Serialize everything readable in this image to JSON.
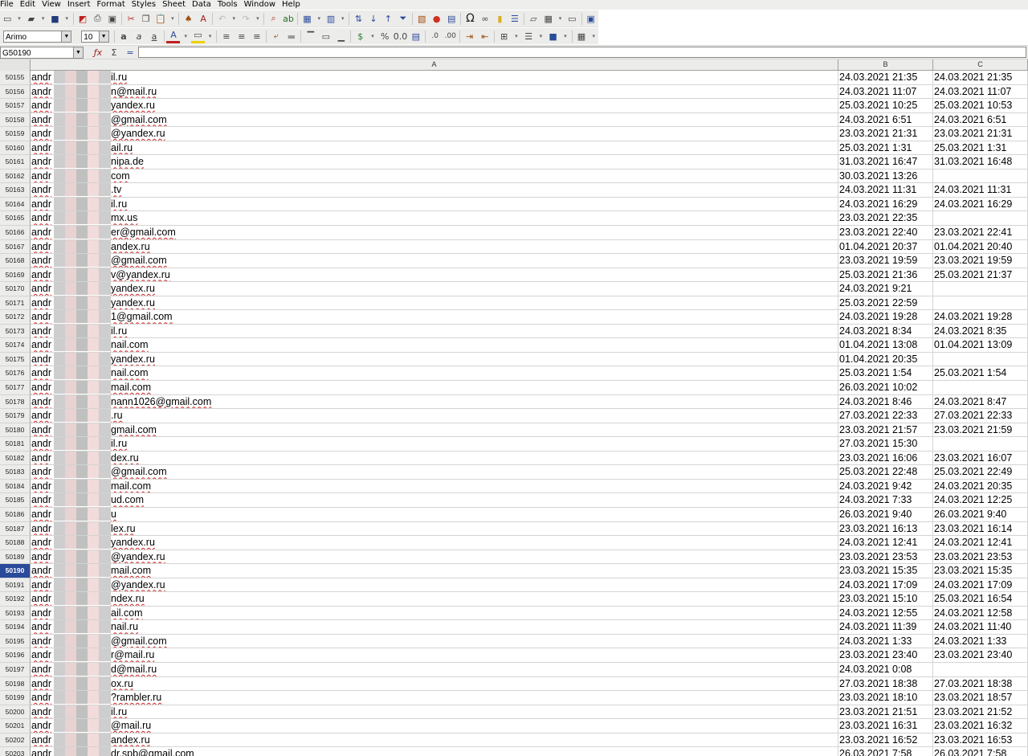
{
  "menu": [
    "File",
    "Edit",
    "View",
    "Insert",
    "Format",
    "Styles",
    "Sheet",
    "Data",
    "Tools",
    "Window",
    "Help"
  ],
  "font": {
    "name": "Arimo",
    "size": "10"
  },
  "name_box": "G50190",
  "columns": [
    "A",
    "B",
    "C"
  ],
  "active_row": "50190",
  "rows": [
    {
      "n": "50155",
      "pre": "andr",
      "suf": "il.ru",
      "b": "24.03.2021 21:35",
      "c": "24.03.2021 21:35"
    },
    {
      "n": "50156",
      "pre": "andr",
      "suf": "n@mail.ru",
      "b": "24.03.2021 11:07",
      "c": "24.03.2021 11:07"
    },
    {
      "n": "50157",
      "pre": "andr",
      "suf": "yandex.ru",
      "b": "25.03.2021 10:25",
      "c": "25.03.2021 10:53"
    },
    {
      "n": "50158",
      "pre": "andr",
      "suf": "@gmail.com",
      "b": "24.03.2021 6:51",
      "c": "24.03.2021 6:51"
    },
    {
      "n": "50159",
      "pre": "andr",
      "suf": "@yandex.ru",
      "b": "23.03.2021 21:31",
      "c": "23.03.2021 21:31"
    },
    {
      "n": "50160",
      "pre": "andr",
      "suf": "ail.ru",
      "b": "25.03.2021 1:31",
      "c": "25.03.2021 1:31"
    },
    {
      "n": "50161",
      "pre": "andr",
      "suf": "nipa.de",
      "b": "31.03.2021 16:47",
      "c": "31.03.2021 16:48"
    },
    {
      "n": "50162",
      "pre": "andr",
      "suf": "com",
      "b": "30.03.2021 13:26",
      "c": ""
    },
    {
      "n": "50163",
      "pre": "andr",
      "suf": ".tv",
      "b": "24.03.2021 11:31",
      "c": "24.03.2021 11:31"
    },
    {
      "n": "50164",
      "pre": "andr",
      "suf": "il.ru",
      "b": "24.03.2021 16:29",
      "c": "24.03.2021 16:29"
    },
    {
      "n": "50165",
      "pre": "andr",
      "suf": "mx.us",
      "b": "23.03.2021 22:35",
      "c": ""
    },
    {
      "n": "50166",
      "pre": "andr",
      "suf": "er@gmail.com",
      "b": "23.03.2021 22:40",
      "c": "23.03.2021 22:41"
    },
    {
      "n": "50167",
      "pre": "andr",
      "suf": "andex.ru",
      "b": "01.04.2021 20:37",
      "c": "01.04.2021 20:40"
    },
    {
      "n": "50168",
      "pre": "andr",
      "suf": "@gmail.com",
      "b": "23.03.2021 19:59",
      "c": "23.03.2021 19:59"
    },
    {
      "n": "50169",
      "pre": "andr",
      "suf": "v@yandex.ru",
      "b": "25.03.2021 21:36",
      "c": "25.03.2021 21:37"
    },
    {
      "n": "50170",
      "pre": "andr",
      "suf": "yandex.ru",
      "b": "24.03.2021 9:21",
      "c": ""
    },
    {
      "n": "50171",
      "pre": "andr",
      "suf": "yandex.ru",
      "b": "25.03.2021 22:59",
      "c": ""
    },
    {
      "n": "50172",
      "pre": "andr",
      "suf": "1@gmail.com",
      "b": "24.03.2021 19:28",
      "c": "24.03.2021 19:28"
    },
    {
      "n": "50173",
      "pre": "andr",
      "suf": "il.ru",
      "b": "24.03.2021 8:34",
      "c": "24.03.2021 8:35"
    },
    {
      "n": "50174",
      "pre": "andr",
      "suf": "nail.com",
      "b": "01.04.2021 13:08",
      "c": "01.04.2021 13:09"
    },
    {
      "n": "50175",
      "pre": "andr",
      "suf": "yandex.ru",
      "b": "01.04.2021 20:35",
      "c": ""
    },
    {
      "n": "50176",
      "pre": "andr",
      "suf": "nail.com",
      "b": "25.03.2021 1:54",
      "c": "25.03.2021 1:54"
    },
    {
      "n": "50177",
      "pre": "andr",
      "suf": "mail.com",
      "b": "26.03.2021 10:02",
      "c": ""
    },
    {
      "n": "50178",
      "pre": "andr",
      "suf": "nann1026@gmail.com",
      "b": "24.03.2021 8:46",
      "c": "24.03.2021 8:47"
    },
    {
      "n": "50179",
      "pre": "andr",
      "suf": ".ru",
      "b": "27.03.2021 22:33",
      "c": "27.03.2021 22:33"
    },
    {
      "n": "50180",
      "pre": "andr",
      "suf": "gmail.com",
      "b": "23.03.2021 21:57",
      "c": "23.03.2021 21:59"
    },
    {
      "n": "50181",
      "pre": "andr",
      "suf": "il.ru",
      "b": "27.03.2021 15:30",
      "c": ""
    },
    {
      "n": "50182",
      "pre": "andr",
      "suf": "dex.ru",
      "b": "23.03.2021 16:06",
      "c": "23.03.2021 16:07"
    },
    {
      "n": "50183",
      "pre": "andr",
      "suf": "@gmail.com",
      "b": "25.03.2021 22:48",
      "c": "25.03.2021 22:49"
    },
    {
      "n": "50184",
      "pre": "andr",
      "suf": "mail.com",
      "b": "24.03.2021 9:42",
      "c": "24.03.2021 20:35"
    },
    {
      "n": "50185",
      "pre": "andr",
      "suf": "ud.com",
      "b": "24.03.2021 7:33",
      "c": "24.03.2021 12:25"
    },
    {
      "n": "50186",
      "pre": "andr",
      "suf": "u",
      "b": "26.03.2021 9:40",
      "c": "26.03.2021 9:40"
    },
    {
      "n": "50187",
      "pre": "andr",
      "suf": "lex.ru",
      "b": "23.03.2021 16:13",
      "c": "23.03.2021 16:14"
    },
    {
      "n": "50188",
      "pre": "andr",
      "suf": "yandex.ru",
      "b": "24.03.2021 12:41",
      "c": "24.03.2021 12:41"
    },
    {
      "n": "50189",
      "pre": "andr",
      "suf": "@yandex.ru",
      "b": "23.03.2021 23:53",
      "c": "23.03.2021 23:53"
    },
    {
      "n": "50190",
      "pre": "andr",
      "suf": "mail.com",
      "b": "23.03.2021 15:35",
      "c": "23.03.2021 15:35"
    },
    {
      "n": "50191",
      "pre": "andr",
      "suf": "@yandex.ru",
      "b": "24.03.2021 17:09",
      "c": "24.03.2021 17:09"
    },
    {
      "n": "50192",
      "pre": "andr",
      "suf": "ndex.ru",
      "b": "23.03.2021 15:10",
      "c": "25.03.2021 16:54"
    },
    {
      "n": "50193",
      "pre": "andr",
      "suf": "ail.com",
      "b": "24.03.2021 12:55",
      "c": "24.03.2021 12:58"
    },
    {
      "n": "50194",
      "pre": "andr",
      "suf": "nail.ru",
      "b": "24.03.2021 11:39",
      "c": "24.03.2021 11:40"
    },
    {
      "n": "50195",
      "pre": "andr",
      "suf": "@gmail.com",
      "b": "24.03.2021 1:33",
      "c": "24.03.2021 1:33"
    },
    {
      "n": "50196",
      "pre": "andr",
      "suf": "r@mail.ru",
      "b": "23.03.2021 23:40",
      "c": "23.03.2021 23:40"
    },
    {
      "n": "50197",
      "pre": "andr",
      "suf": "d@mail.ru",
      "b": "24.03.2021 0:08",
      "c": ""
    },
    {
      "n": "50198",
      "pre": "andr",
      "suf": "ox.ru",
      "b": "27.03.2021 18:38",
      "c": "27.03.2021 18:38"
    },
    {
      "n": "50199",
      "pre": "andr",
      "suf": "?rambler.ru",
      "b": "23.03.2021 18:10",
      "c": "23.03.2021 18:57"
    },
    {
      "n": "50200",
      "pre": "andr",
      "suf": "il.ru",
      "b": "23.03.2021 21:51",
      "c": "23.03.2021 21:52"
    },
    {
      "n": "50201",
      "pre": "andr",
      "suf": "@mail.ru",
      "b": "23.03.2021 16:31",
      "c": "23.03.2021 16:32"
    },
    {
      "n": "50202",
      "pre": "andr",
      "suf": "andex.ru",
      "b": "23.03.2021 16:52",
      "c": "23.03.2021 16:53"
    },
    {
      "n": "50203",
      "pre": "andr",
      "suf": "dr.spb@gmail.com",
      "b": "26.03.2021 7:58",
      "c": "26.03.2021 7:58"
    }
  ]
}
